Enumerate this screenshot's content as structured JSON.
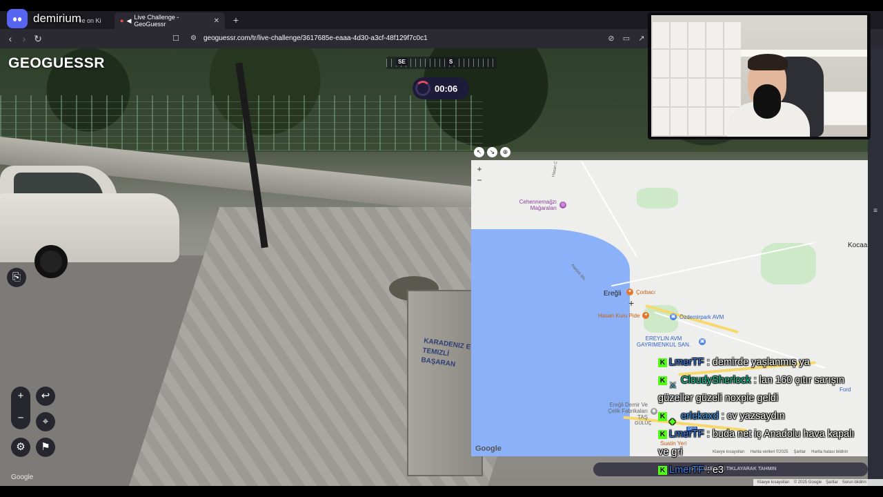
{
  "overlay": {
    "discord_name": "demirium"
  },
  "browser": {
    "tabs": [
      {
        "label": "ve on Ki",
        "active": false
      },
      {
        "label": "Live Challenge - GeoGuessr",
        "active": true
      }
    ],
    "url": "geoguessr.com/tr/live-challenge/3617685e-eaaa-4d30-a3cf-48f129f7c0c1"
  },
  "game": {
    "logo": "GEOGUESSR",
    "compass": [
      "SE",
      "S"
    ],
    "timer": "00:06",
    "bottom_banner": "HARITA ÜZERINE TIKLAYARAK TAHMIN",
    "google_label": "Google",
    "attribution": [
      "Klavye kısayolları",
      "© 2025 Google",
      "Şartlar",
      "Sorun bildirin"
    ]
  },
  "map": {
    "places": {
      "eregli": "Ereğli",
      "kocaali": "Kocaa",
      "gulu": "GÜLÜÇ",
      "hasan": "Hasan C",
      "ataturk": "Atatürk Blv."
    },
    "pois": {
      "cehennem": "Cehennemağzı Mağaraları",
      "corbaci": "Çorbacı",
      "hasankuru": "Hasan Kuru Pide",
      "ozdemir": "Özdemirpark AVM",
      "ereylin": "EREYLIN AVM GAYRIMENKUL SAN.",
      "ford": "Ford",
      "erdemir": "Ereğli Demir Ve Çelik Fabrikaları TAŞ",
      "suatin": "Suatin Yeri"
    },
    "road_sign": "D010",
    "google_label": "Google",
    "footer": [
      "Klavye kısayolları",
      "Harita verileri ©2025",
      "Şartlar",
      "Harita hatası bildirin"
    ]
  },
  "scene": {
    "bin_text": "KARADENIZ E\nTEMIZLİ\nBAŞARAN"
  },
  "chat": [
    {
      "badge": "K",
      "user": "LmerTF",
      "color": "blue",
      "text": ": demirde yaşlanmış ya"
    },
    {
      "badge": "K",
      "extra": "sword",
      "user": "CloudySherlock",
      "color": "teal",
      "text": ": lan 160 çıtır sarışın güzeller güzeli noxpie geldi"
    },
    {
      "badge": "K",
      "extra": "gem",
      "user": "erlekaxd",
      "color": "sky",
      "text": ": cv yazsaydın"
    },
    {
      "badge": "K",
      "user": "LmerTF",
      "color": "blue",
      "text": ": buda net iç Anadolu hava kapalı ve gri"
    },
    {
      "badge": "K",
      "user": "LmerTF",
      "color": "blue",
      "text": ": e3"
    }
  ]
}
